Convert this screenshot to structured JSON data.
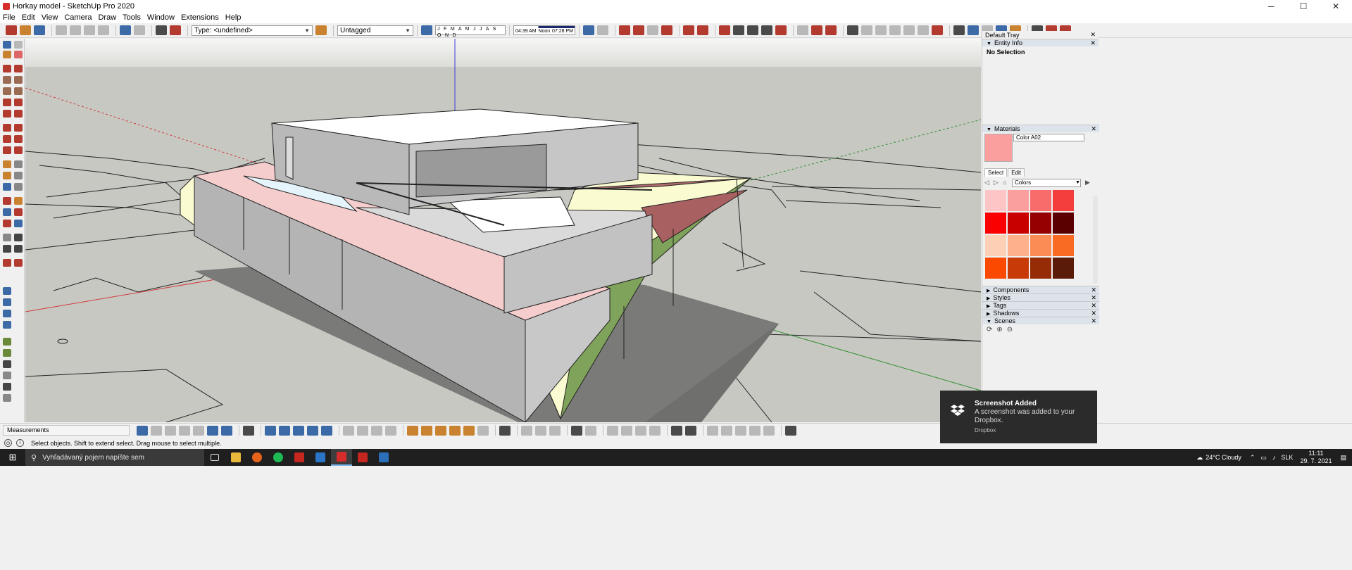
{
  "window": {
    "title": "Horkay model - SketchUp Pro 2020",
    "minimize": "─",
    "maximize": "☐",
    "close": "✕"
  },
  "menu": [
    "File",
    "Edit",
    "View",
    "Camera",
    "Draw",
    "Tools",
    "Window",
    "Extensions",
    "Help"
  ],
  "toolbar": {
    "type_select": "Type: <undefined>",
    "tag_select": "Untagged",
    "months": "J F M A M J J A S O N D",
    "time_start": "04:39 AM",
    "time_mid": "Noon",
    "time_end": "07:28 PM"
  },
  "tray": {
    "title": "Default Tray",
    "entity_info": {
      "label": "Entity Info",
      "selection": "No Selection"
    },
    "materials": {
      "label": "Materials",
      "name": "Color A02",
      "swatch_color": "#fb9e9e",
      "tab_select": "Select",
      "tab_edit": "Edit",
      "library": "Colors",
      "colors": [
        "#fdc5c5",
        "#fb9e9e",
        "#f86c6c",
        "#f43d3d",
        "#fa0000",
        "#c80000",
        "#960000",
        "#5a0000",
        "#fdd0b6",
        "#fdb08a",
        "#fb8c55",
        "#f96a22",
        "#fb4a00",
        "#c83b08",
        "#962c06",
        "#5a1c08"
      ]
    },
    "panels": [
      "Components",
      "Styles",
      "Tags",
      "Shadows",
      "Scenes"
    ]
  },
  "status": {
    "measurements_label": "Measurements",
    "hint": "Select objects. Shift to extend select. Drag mouse to select multiple."
  },
  "taskbar": {
    "search_placeholder": "Vyhľadávaný pojem napíšte sem",
    "weather": "24°C  Cloudy",
    "language": "SLK",
    "time": "11:11",
    "date": "29. 7. 2021"
  },
  "notification": {
    "title": "Screenshot Added",
    "message": "A screenshot was added to your Dropbox.",
    "source": "Dropbox"
  }
}
